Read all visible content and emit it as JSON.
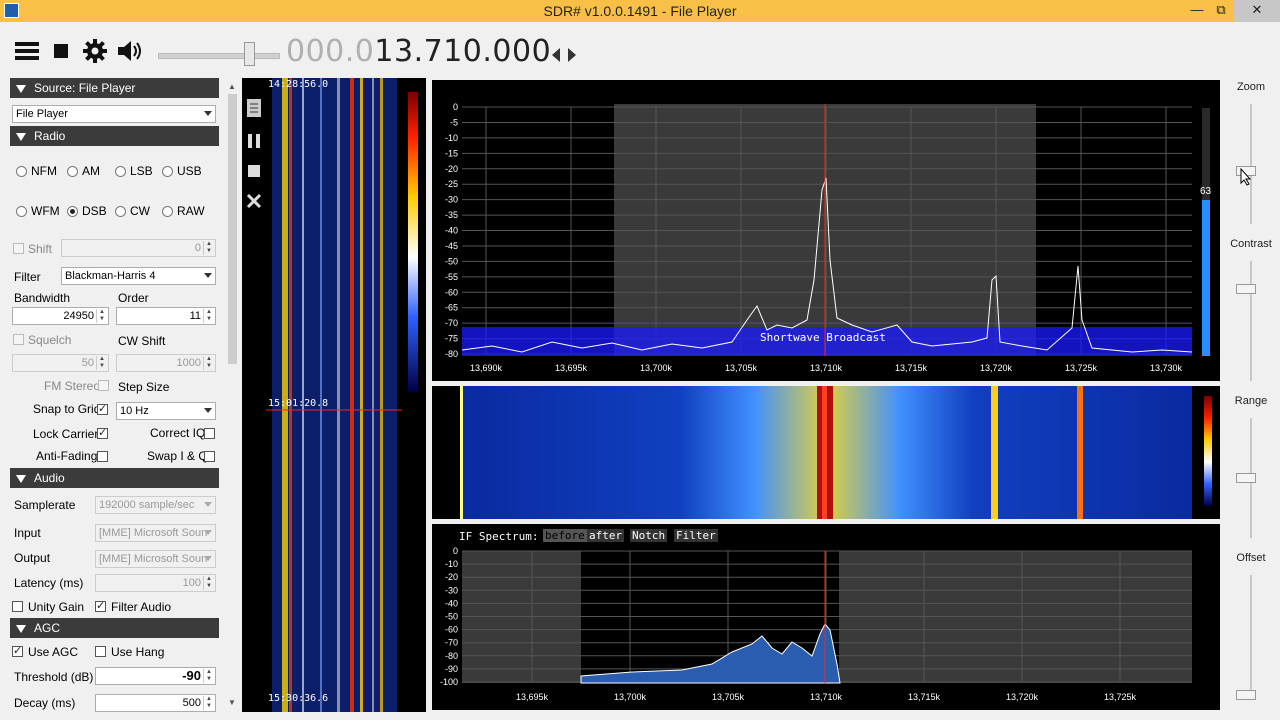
{
  "window": {
    "title": "SDR# v1.0.0.1491 - File Player"
  },
  "toolbar": {
    "freq_dim": "000.0",
    "freq_bright": "13.710.000"
  },
  "source": {
    "header": "Source: File Player",
    "selected": "File Player"
  },
  "radio": {
    "header": "Radio",
    "modes": [
      "NFM",
      "AM",
      "LSB",
      "USB",
      "WFM",
      "DSB",
      "CW",
      "RAW"
    ],
    "selected_mode": "DSB",
    "shift_label": "Shift",
    "shift_value": "0",
    "filter_label": "Filter",
    "filter_value": "Blackman-Harris 4",
    "bandwidth_label": "Bandwidth",
    "bandwidth_value": "24950",
    "order_label": "Order",
    "order_value": "11",
    "squelch_label": "Squelch",
    "squelch_value": "50",
    "cwshift_label": "CW Shift",
    "cwshift_value": "1000",
    "fmstereo_label": "FM Stereo",
    "stepsize_label": "Step Size",
    "snap_label": "Snap to Grid",
    "snap_value": "10 Hz",
    "lockcarrier_label": "Lock Carrier",
    "correctiq_label": "Correct IQ",
    "antifading_label": "Anti-Fading",
    "swapiq_label": "Swap I & Q"
  },
  "audio": {
    "header": "Audio",
    "samplerate_label": "Samplerate",
    "samplerate_value": "192000 sample/sec",
    "input_label": "Input",
    "input_value": "[MME] Microsoft Soun",
    "output_label": "Output",
    "output_value": "[MME] Microsoft Soun",
    "latency_label": "Latency (ms)",
    "latency_value": "100",
    "unitygain_label": "Unity Gain",
    "filteraudio_label": "Filter Audio"
  },
  "agc": {
    "header": "AGC",
    "useagc_label": "Use AGC",
    "usehang_label": "Use Hang",
    "threshold_label": "Threshold (dB)",
    "threshold_value": "-90",
    "decay_label": "Decay (ms)",
    "decay_value": "500"
  },
  "waterfall_left": {
    "time_top": "14:28:56.0",
    "time_mid": "15:01:20.8",
    "time_bottom": "15:30:36.6"
  },
  "spectrum": {
    "y_ticks": [
      "0",
      "-5",
      "-10",
      "-15",
      "-20",
      "-25",
      "-30",
      "-35",
      "-40",
      "-45",
      "-50",
      "-55",
      "-60",
      "-65",
      "-70",
      "-75",
      "-80"
    ],
    "x_ticks": [
      "13,690k",
      "13,695k",
      "13,700k",
      "13,705k",
      "13,710k",
      "13,715k",
      "13,720k",
      "13,725k",
      "13,730k"
    ],
    "band_label": "Shortwave Broadcast",
    "level_value": "63"
  },
  "ifspectrum": {
    "title": "IF Spectrum:",
    "btn_before": "before",
    "btn_after": "after",
    "btn_notch": "Notch",
    "btn_filter": "Filter",
    "y_ticks": [
      "0",
      "-10",
      "-20",
      "-30",
      "-40",
      "-50",
      "-60",
      "-70",
      "-80",
      "-90",
      "-100"
    ],
    "x_ticks": [
      "13,695k",
      "13,700k",
      "13,705k",
      "13,710k",
      "13,715k",
      "13,720k",
      "13,725k"
    ]
  },
  "rightpanel": {
    "zoom": "Zoom",
    "contrast": "Contrast",
    "range": "Range",
    "offset": "Offset"
  },
  "colors": {
    "titlebar": "#f8c046",
    "section_header": "#3b3b3b",
    "band_fill": "#1a1aff",
    "vfo_line": "#ff2020"
  }
}
